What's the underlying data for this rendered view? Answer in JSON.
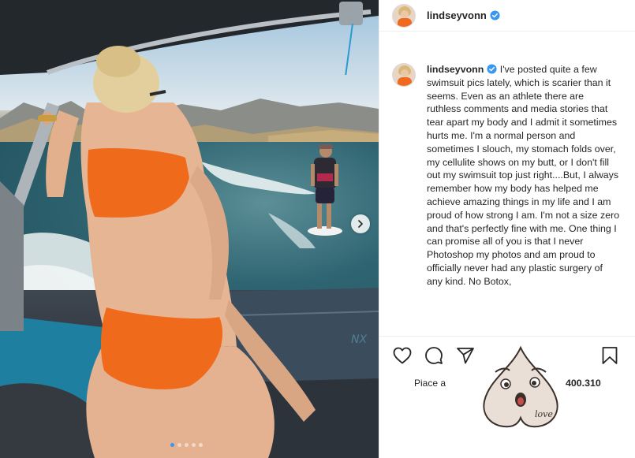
{
  "post": {
    "username": "lindseyvonn",
    "verified": true,
    "caption": "I've posted quite a few swimsuit pics lately, which is scarier than it seems. Even as an athlete there are ruthless comments and media stories that tear apart my body and I admit it sometimes hurts me. I'm a normal person and sometimes I slouch, my stomach folds over, my cellulite shows on my butt, or I don't fill out my swimsuit top just right....But, I always remember how my body has helped me achieve amazing things in my life and I am proud of how strong I am.  I'm not a size zero and that's perfectly fine with me. One thing I can promise all of you is that I never Photoshop my photos and am proud to officially never had any plastic surgery of any kind. No Botox,",
    "likes_prefix": "Piace a",
    "likes_count": "400.310"
  },
  "photo": {
    "carousel_dots": 5,
    "active_dot": 0,
    "boat_logo": "NX"
  },
  "icons": {
    "like": "heart-icon",
    "comment": "comment-icon",
    "share": "paper-plane-icon",
    "save": "bookmark-icon",
    "next": "chevron-right-icon",
    "verified": "verified-badge-icon"
  },
  "sticker": {
    "text": "love"
  },
  "colors": {
    "verified": "#3897f0",
    "swimsuit": "#f06a1c",
    "active_dot": "#3897f0"
  }
}
